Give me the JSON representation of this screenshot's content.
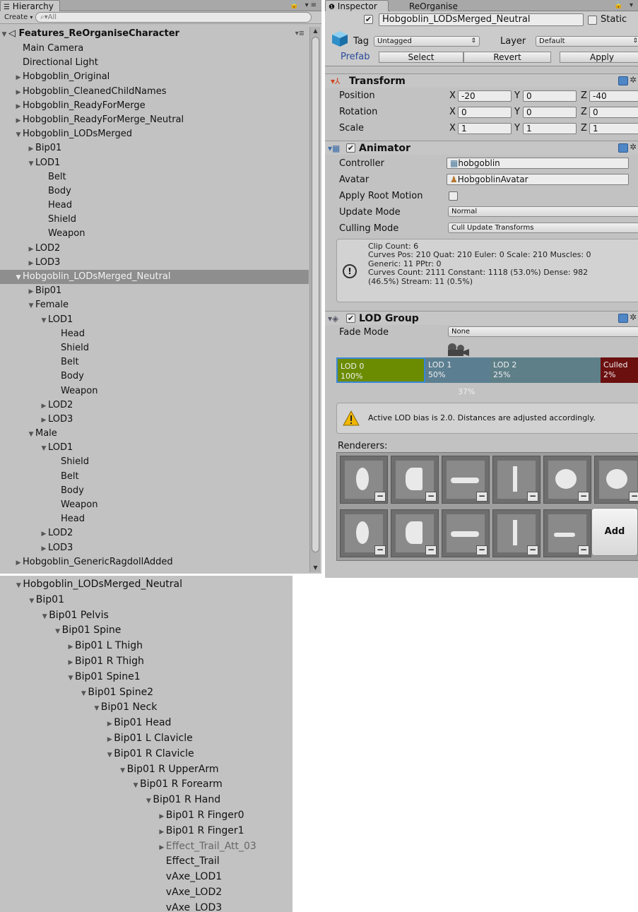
{
  "hierarchy": {
    "tab_label": "Hierarchy",
    "create_label": "Create",
    "search_placeholder": "All",
    "root": "Features_ReOrganiseCharacter",
    "rows": [
      {
        "label": "Main Camera",
        "indent": 1,
        "arrow": "",
        "selected": false
      },
      {
        "label": "Directional Light",
        "indent": 1,
        "arrow": "",
        "selected": false
      },
      {
        "label": "Hobgoblin_Original",
        "indent": 1,
        "arrow": "right",
        "selected": false
      },
      {
        "label": "Hobgoblin_CleanedChildNames",
        "indent": 1,
        "arrow": "right",
        "selected": false
      },
      {
        "label": "Hobgoblin_ReadyForMerge",
        "indent": 1,
        "arrow": "right",
        "selected": false
      },
      {
        "label": "Hobgoblin_ReadyForMerge_Neutral",
        "indent": 1,
        "arrow": "right",
        "selected": false
      },
      {
        "label": "Hobgoblin_LODsMerged",
        "indent": 1,
        "arrow": "down",
        "selected": false
      },
      {
        "label": "Bip01",
        "indent": 2,
        "arrow": "right",
        "selected": false
      },
      {
        "label": "LOD1",
        "indent": 2,
        "arrow": "down",
        "selected": false
      },
      {
        "label": "Belt",
        "indent": 3,
        "arrow": "",
        "selected": false
      },
      {
        "label": "Body",
        "indent": 3,
        "arrow": "",
        "selected": false
      },
      {
        "label": "Head",
        "indent": 3,
        "arrow": "",
        "selected": false
      },
      {
        "label": "Shield",
        "indent": 3,
        "arrow": "",
        "selected": false
      },
      {
        "label": "Weapon",
        "indent": 3,
        "arrow": "",
        "selected": false
      },
      {
        "label": "LOD2",
        "indent": 2,
        "arrow": "right",
        "selected": false
      },
      {
        "label": "LOD3",
        "indent": 2,
        "arrow": "right",
        "selected": false
      },
      {
        "label": "Hobgoblin_LODsMerged_Neutral",
        "indent": 1,
        "arrow": "down",
        "selected": true
      },
      {
        "label": "Bip01",
        "indent": 2,
        "arrow": "right",
        "selected": false
      },
      {
        "label": "Female",
        "indent": 2,
        "arrow": "down",
        "selected": false
      },
      {
        "label": "LOD1",
        "indent": 3,
        "arrow": "down",
        "selected": false
      },
      {
        "label": "Head",
        "indent": 4,
        "arrow": "",
        "selected": false
      },
      {
        "label": "Shield",
        "indent": 4,
        "arrow": "",
        "selected": false
      },
      {
        "label": "Belt",
        "indent": 4,
        "arrow": "",
        "selected": false
      },
      {
        "label": "Body",
        "indent": 4,
        "arrow": "",
        "selected": false
      },
      {
        "label": "Weapon",
        "indent": 4,
        "arrow": "",
        "selected": false
      },
      {
        "label": "LOD2",
        "indent": 3,
        "arrow": "right",
        "selected": false
      },
      {
        "label": "LOD3",
        "indent": 3,
        "arrow": "right",
        "selected": false
      },
      {
        "label": "Male",
        "indent": 2,
        "arrow": "down",
        "selected": false
      },
      {
        "label": "LOD1",
        "indent": 3,
        "arrow": "down",
        "selected": false
      },
      {
        "label": "Shield",
        "indent": 4,
        "arrow": "",
        "selected": false
      },
      {
        "label": "Belt",
        "indent": 4,
        "arrow": "",
        "selected": false
      },
      {
        "label": "Body",
        "indent": 4,
        "arrow": "",
        "selected": false
      },
      {
        "label": "Weapon",
        "indent": 4,
        "arrow": "",
        "selected": false
      },
      {
        "label": "Head",
        "indent": 4,
        "arrow": "",
        "selected": false
      },
      {
        "label": "LOD2",
        "indent": 3,
        "arrow": "right",
        "selected": false
      },
      {
        "label": "LOD3",
        "indent": 3,
        "arrow": "right",
        "selected": false
      },
      {
        "label": "Hobgoblin_GenericRagdollAdded",
        "indent": 0,
        "arrow": "right",
        "selected": false
      }
    ]
  },
  "inspector": {
    "tabs": [
      "Inspector",
      "ReOrganise"
    ],
    "object_name": "Hobgoblin_LODsMerged_Neutral",
    "static_label": "Static",
    "tag_label": "Tag",
    "tag_value": "Untagged",
    "layer_label": "Layer",
    "layer_value": "Default",
    "prefab_label": "Prefab",
    "prefab_buttons": [
      "Select",
      "Revert",
      "Apply"
    ],
    "transform": {
      "title": "Transform",
      "rows": [
        {
          "label": "Position",
          "x": "-20",
          "y": "0",
          "z": "-40"
        },
        {
          "label": "Rotation",
          "x": "0",
          "y": "0",
          "z": "0"
        },
        {
          "label": "Scale",
          "x": "1",
          "y": "1",
          "z": "1"
        }
      ]
    },
    "animator": {
      "title": "Animator",
      "controller_label": "Controller",
      "controller_value": "hobgoblin",
      "avatar_label": "Avatar",
      "avatar_value": "HobgoblinAvatar",
      "root_motion_label": "Apply Root Motion",
      "update_mode_label": "Update Mode",
      "update_mode_value": "Normal",
      "culling_mode_label": "Culling Mode",
      "culling_mode_value": "Cull Update Transforms",
      "info_lines": [
        "Clip Count: 6",
        "Curves Pos: 210 Quat: 210 Euler: 0 Scale: 210 Muscles: 0",
        "Generic: 11 PPtr: 0",
        "Curves Count: 2111 Constant: 1118 (53.0%) Dense: 982",
        "(46.5%) Stream: 11 (0.5%)"
      ]
    },
    "lod_group": {
      "title": "LOD Group",
      "fade_mode_label": "Fade Mode",
      "fade_mode_value": "None",
      "segments": [
        {
          "name": "LOD 0",
          "pct": "100%",
          "color": "#6b8c00"
        },
        {
          "name": "LOD 1",
          "pct": "50%",
          "color": "#5b7f91"
        },
        {
          "name": "LOD 2",
          "pct": "25%",
          "color": "#5e7f88"
        },
        {
          "name": "Culled",
          "pct": "2%",
          "color": "#6b0f0f"
        }
      ],
      "camera_pct": "37%",
      "warning": "Active LOD bias is 2.0. Distances are adjusted accordingly.",
      "renderers_label": "Renderers:",
      "add_label": "Add"
    }
  },
  "bottom_tree": {
    "rows": [
      {
        "label": "Hobgoblin_LODsMerged_Neutral",
        "indent": 1,
        "arrow": "down",
        "dim": false
      },
      {
        "label": "Bip01",
        "indent": 2,
        "arrow": "down",
        "dim": false
      },
      {
        "label": "Bip01 Pelvis",
        "indent": 3,
        "arrow": "down",
        "dim": false
      },
      {
        "label": "Bip01 Spine",
        "indent": 4,
        "arrow": "down",
        "dim": false
      },
      {
        "label": "Bip01 L Thigh",
        "indent": 5,
        "arrow": "right",
        "dim": false
      },
      {
        "label": "Bip01 R Thigh",
        "indent": 5,
        "arrow": "right",
        "dim": false
      },
      {
        "label": "Bip01 Spine1",
        "indent": 5,
        "arrow": "down",
        "dim": false
      },
      {
        "label": "Bip01 Spine2",
        "indent": 6,
        "arrow": "down",
        "dim": false
      },
      {
        "label": "Bip01 Neck",
        "indent": 7,
        "arrow": "down",
        "dim": false
      },
      {
        "label": "Bip01 Head",
        "indent": 8,
        "arrow": "right",
        "dim": false
      },
      {
        "label": "Bip01 L Clavicle",
        "indent": 8,
        "arrow": "right",
        "dim": false
      },
      {
        "label": "Bip01 R Clavicle",
        "indent": 8,
        "arrow": "down",
        "dim": false
      },
      {
        "label": "Bip01 R UpperArm",
        "indent": 9,
        "arrow": "down",
        "dim": false
      },
      {
        "label": "Bip01 R Forearm",
        "indent": 10,
        "arrow": "down",
        "dim": false
      },
      {
        "label": "Bip01 R Hand",
        "indent": 11,
        "arrow": "down",
        "dim": false
      },
      {
        "label": "Bip01 R Finger0",
        "indent": 12,
        "arrow": "right",
        "dim": false
      },
      {
        "label": "Bip01 R Finger1",
        "indent": 12,
        "arrow": "right",
        "dim": false
      },
      {
        "label": "Effect_Trail_Att_03",
        "indent": 12,
        "arrow": "right",
        "dim": true
      },
      {
        "label": "Effect_Trail",
        "indent": 12,
        "arrow": "",
        "dim": false
      },
      {
        "label": "vAxe_LOD1",
        "indent": 12,
        "arrow": "",
        "dim": false
      },
      {
        "label": "vAxe_LOD2",
        "indent": 12,
        "arrow": "",
        "dim": false
      },
      {
        "label": "vAxe_LOD3",
        "indent": 12,
        "arrow": "",
        "dim": false
      }
    ]
  }
}
